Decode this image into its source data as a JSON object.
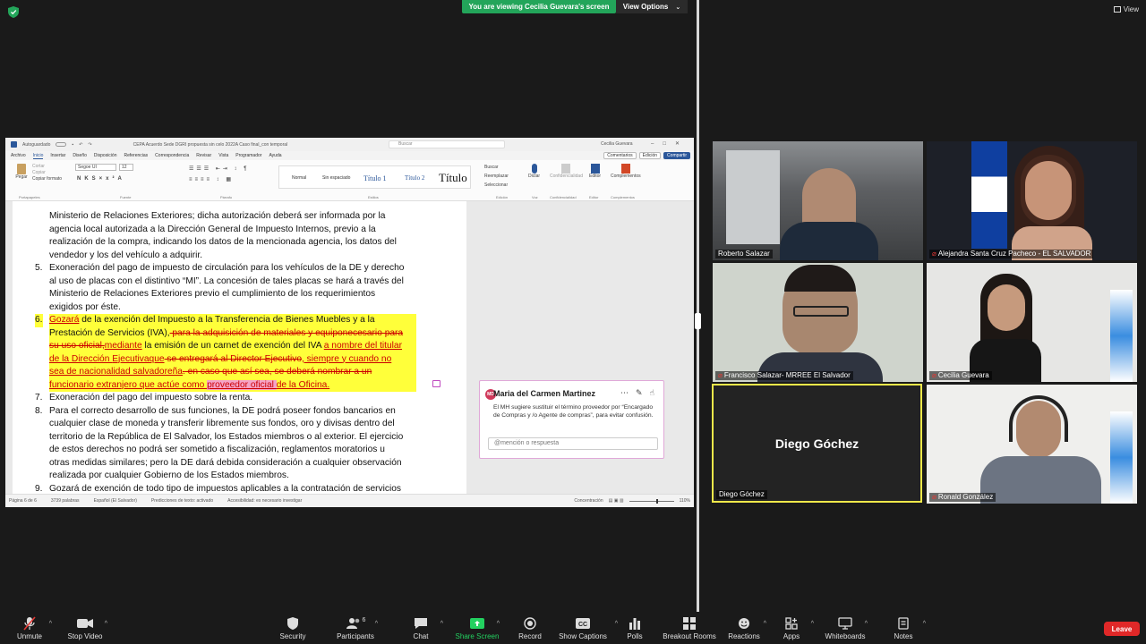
{
  "meeting": {
    "viewing_banner": "You are viewing Cecilia Guevara's screen",
    "view_options": "View Options",
    "view_button": "View",
    "colors": {
      "banner_green": "#23a55a",
      "leave_red": "#e02828",
      "active_speaker": "#f0e84a"
    }
  },
  "word": {
    "title_left": "Autoguardado",
    "title_doc": "CEPA Acuerdo Sede DGRI propuesta sin celo 2022A Caso final_con temporal",
    "search_placeholder": "Buscar",
    "user": "Cecilia Guevara",
    "menu": [
      "Archivo",
      "Inicio",
      "Insertar",
      "Diseño",
      "Disposición",
      "Referencias",
      "Correspondencia",
      "Revisar",
      "Vista",
      "Programador",
      "Ayuda"
    ],
    "menu_active": "Inicio",
    "menu_right": {
      "comments": "Comentarios",
      "editing": "Edición",
      "share": "Compartir"
    },
    "ribbon": {
      "paste": "Pegar",
      "cut": "Cortar",
      "copy": "Copiar",
      "format_painter": "Copiar formato",
      "clipboard_label": "Portapapeles",
      "font_name": "Segoe UI",
      "font_size": "12",
      "font_label": "Fuente",
      "paragraph_label": "Párrafo",
      "styles_label": "Estilos",
      "styles": [
        "Normal",
        "Sin espaciado",
        "Título 1",
        "Título 2",
        "Título"
      ],
      "find": "Buscar",
      "replace": "Reemplazar",
      "select": "Seleccionar",
      "editing_label": "Edición",
      "dictate": "Dictar",
      "voice_label": "Voz",
      "sensitivity": "Confidencialidad",
      "sensitivity_label": "Confidencialidad",
      "editor": "Editor",
      "editor_label": "Editor",
      "addins": "Complementos",
      "addins_label": "Complementos"
    },
    "doc": {
      "p4_lines": [
        "Ministerio de Relaciones Exteriores; dicha autorización deberá ser informada por la",
        "agencia local autorizada a la Dirección General de Impuesto Internos, previo a la",
        "realización de la compra, indicando los datos de la mencionada agencia, los datos del",
        "vendedor y los del vehículo a adquirir."
      ],
      "p5_num": "5.",
      "p5_lines": [
        "Exoneración del pago de impuesto de circulación para los vehículos de la DE y derecho",
        "al uso de placas con el distintivo “MI”. La concesión de tales placas se hará a través del",
        "Ministerio de Relaciones Exteriores previo el cumplimiento de los requerimientos",
        "exigidos por éste."
      ],
      "p6_num": "6.",
      "p6": {
        "l1a": "Gozará",
        "l1b": " de la exención del Impuesto a la Transferencia de Bienes Muebles y a la",
        "l2a": "Prestación de Servicios (IVA),",
        "l2b": " para la adquisición de materiales y ",
        "l2c": "equiponecesario",
        "l2d": " para",
        "l3a": "su uso oficial,",
        "l3b": "mediante",
        "l3c": " la emisión de un carnet de exención del IVA ",
        "l3d": "a nombre del titular",
        "l4a": "de la Dirección ",
        "l4b": "Ejecutivaque",
        "l4c": " se entregará al Director Ejecutivo",
        "l4d": ", siempre y cuando no",
        "l5a": "sea de nacionalidad ",
        "l5b": "salvadoreña",
        "l5c": ".",
        "l5d": " en caso que así sea, se deberá nombrar a un",
        "l6a": "funcionario extranjero que actúe como ",
        "l6b": "proveedor oficial ",
        "l6c": "de la Oficina."
      },
      "p7_num": "7.",
      "p7_lines": [
        "Exoneración del pago del impuesto sobre la renta."
      ],
      "p8_num": "8.",
      "p8_lines": [
        "Para el correcto desarrollo de sus funciones, la DE podrá poseer fondos bancarios en",
        "cualquier clase de moneda y transferir libremente sus fondos, oro y divisas dentro del",
        "territorio de la República de El Salvador, los Estados miembros o al exterior. El ejercicio",
        "de estos derechos no podrá ser sometido a fiscalización, reglamentos moratorios u",
        "otras medidas similares; pero la DE dará debida consideración a cualquier observación",
        "realizada por cualquier Gobierno de los Estados miembros."
      ],
      "p9_num": "9.",
      "p9_lines": [
        "Gozará de exención de todo tipo de impuestos aplicables a la contratación de servicios"
      ]
    },
    "comment": {
      "initials": "MD",
      "author": "Maria del Carmen Martinez",
      "text": "El MH sugiere sustituir el término proveedor por “Encargado de Compras y /o Agente de compras”, para evitar confusión.",
      "reply_placeholder": "@mención o respuesta"
    },
    "status": {
      "page": "Página 6 de 6",
      "words": "3739 palabras",
      "language": "Español (El Salvador)",
      "predictions": "Predicciones de texto: activado",
      "accessibility": "Accesibilidad: es necesario investigar",
      "focus": "Concentración",
      "zoom": "110%"
    }
  },
  "participants": [
    {
      "name": "Roberto Salazar",
      "muted": false
    },
    {
      "name": "Alejandra Santa Cruz Pacheco - EL SALVADOR",
      "muted": true
    },
    {
      "name": "Francisco Salazar- MRREE El Salvador",
      "muted": true
    },
    {
      "name": "Cecilia Guevara",
      "muted": true
    },
    {
      "name": "Diego Góchez",
      "muted": false,
      "display_name": "Diego Góchez"
    },
    {
      "name": "Ronald González",
      "muted": true
    }
  ],
  "toolbar": {
    "unmute": "Unmute",
    "stop_video": "Stop Video",
    "security": "Security",
    "participants": "Participants",
    "participants_count": "6",
    "chat": "Chat",
    "share_screen": "Share Screen",
    "record": "Record",
    "show_captions": "Show Captions",
    "polls": "Polls",
    "breakout_rooms": "Breakout Rooms",
    "reactions": "Reactions",
    "apps": "Apps",
    "whiteboards": "Whiteboards",
    "notes": "Notes",
    "leave": "Leave"
  }
}
